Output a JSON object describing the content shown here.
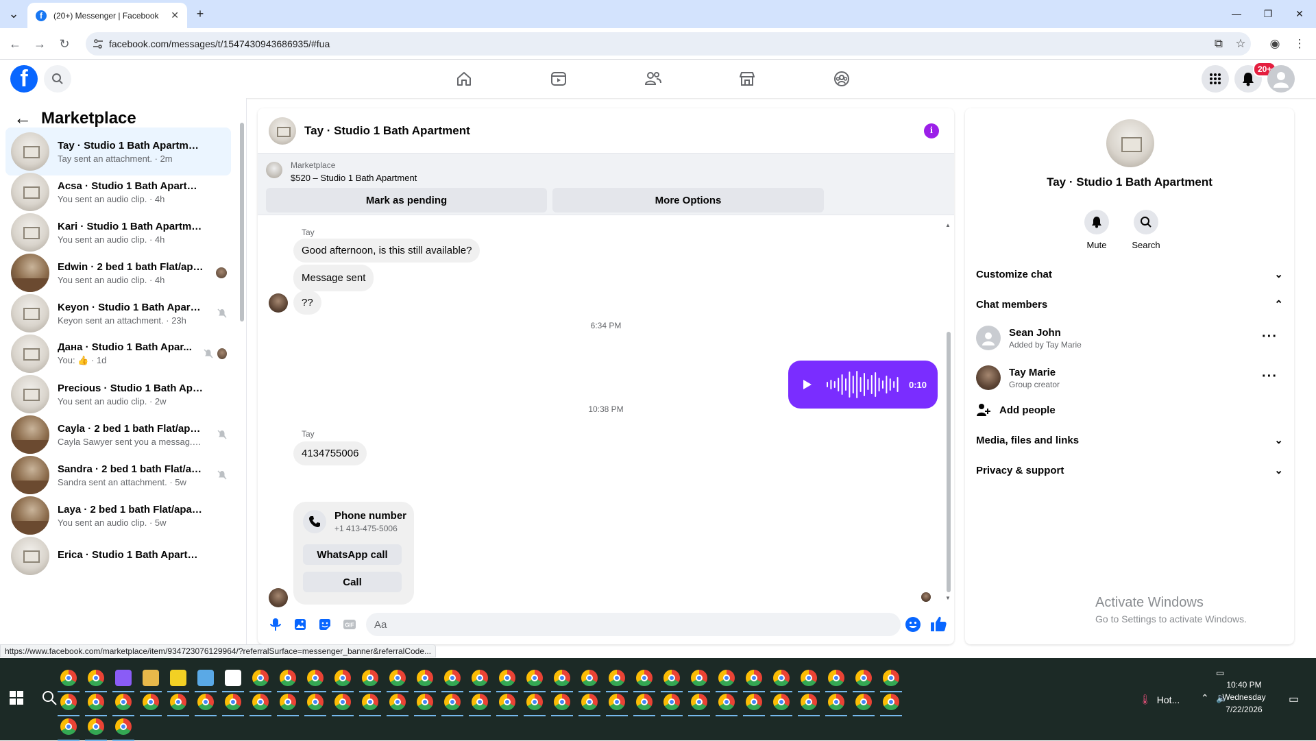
{
  "browser": {
    "tab_title": "(20+) Messenger | Facebook",
    "tab_close": "✕",
    "new_tab": "+",
    "url": "facebook.com/messages/t/1547430943686935/#fua",
    "status_url": "https://www.facebook.com/marketplace/item/934723076129964/?referralSurface=messenger_banner&referralCode..."
  },
  "fb": {
    "logo": "f",
    "notif_badge": "20+"
  },
  "left": {
    "title": "Marketplace",
    "conversations": [
      {
        "name": "Tay · Studio 1 Bath Apartment",
        "sub": "Tay sent an attachment. · 2m",
        "thumb": "white",
        "active": true
      },
      {
        "name": "Acsa · Studio 1 Bath Apartment",
        "sub": "You sent an audio clip. · 4h",
        "thumb": "white"
      },
      {
        "name": "Kari · Studio 1 Bath Apartment",
        "sub": "You sent an audio clip. · 4h",
        "thumb": "white"
      },
      {
        "name": "Edwin · 2 bed 1 bath Flat/apar...",
        "sub": "You sent an audio clip. · 4h",
        "thumb": "wood",
        "tail": "avatar"
      },
      {
        "name": "Keyon · Studio 1 Bath Apartm...",
        "sub": "Keyon sent an attachment. · 23h",
        "thumb": "white",
        "tail": "muted"
      },
      {
        "name": "Дана · Studio 1 Bath Apar...",
        "sub": "You: 👍 · 1d",
        "thumb": "white",
        "tail": "muted-avatar"
      },
      {
        "name": "Precious · Studio 1 Bath Apartm...",
        "sub": "You sent an audio clip. · 2w",
        "thumb": "white"
      },
      {
        "name": "Cayla · 2 bed 1 bath Flat/apart...",
        "sub": "Cayla Sawyer sent you a messag... · 2w",
        "thumb": "wood",
        "tail": "muted"
      },
      {
        "name": "Sandra · 2 bed 1 bath Flat/apa...",
        "sub": "Sandra sent an attachment. · 5w",
        "thumb": "wood",
        "tail": "muted"
      },
      {
        "name": "Laya · 2 bed 1 bath Flat/apartment",
        "sub": "You sent an audio clip. · 5w",
        "thumb": "wood"
      },
      {
        "name": "Erica · Studio 1 Bath Apartment",
        "sub": "",
        "thumb": "white"
      }
    ]
  },
  "chat": {
    "title": "Tay · Studio 1 Bath Apartment",
    "banner_label": "Marketplace",
    "banner_item": "$520 – Studio 1 Bath Apartment",
    "btn_pending": "Mark as pending",
    "btn_more": "More Options",
    "sender1": "Tay",
    "msg1": "Good afternoon, is this still available?",
    "msg2": "Message sent",
    "msg3": "??",
    "time1": "6:34 PM",
    "audio_duration": "0:10",
    "time2": "10:38 PM",
    "sender2": "Tay",
    "msg4": "4134755006",
    "phone_title": "Phone number",
    "phone_number": "+1 413-475-5006",
    "btn_whatsapp": "WhatsApp call",
    "btn_call": "Call",
    "input_placeholder": "Aa"
  },
  "right": {
    "title": "Tay · Studio 1 Bath Apartment",
    "mute": "Mute",
    "search": "Search",
    "customize": "Customize chat",
    "members_title": "Chat members",
    "members": [
      {
        "name": "Sean John",
        "sub": "Added by Tay Marie"
      },
      {
        "name": "Tay Marie",
        "sub": "Group creator"
      }
    ],
    "add_people": "Add people",
    "media": "Media, files and links",
    "privacy": "Privacy & support",
    "activate_title": "Activate Windows",
    "activate_sub": "Go to Settings to activate Windows."
  },
  "taskbar": {
    "time": "10:40 PM",
    "day": "Wednesday",
    "date": "7/22/2026",
    "weather": "Hot..."
  }
}
